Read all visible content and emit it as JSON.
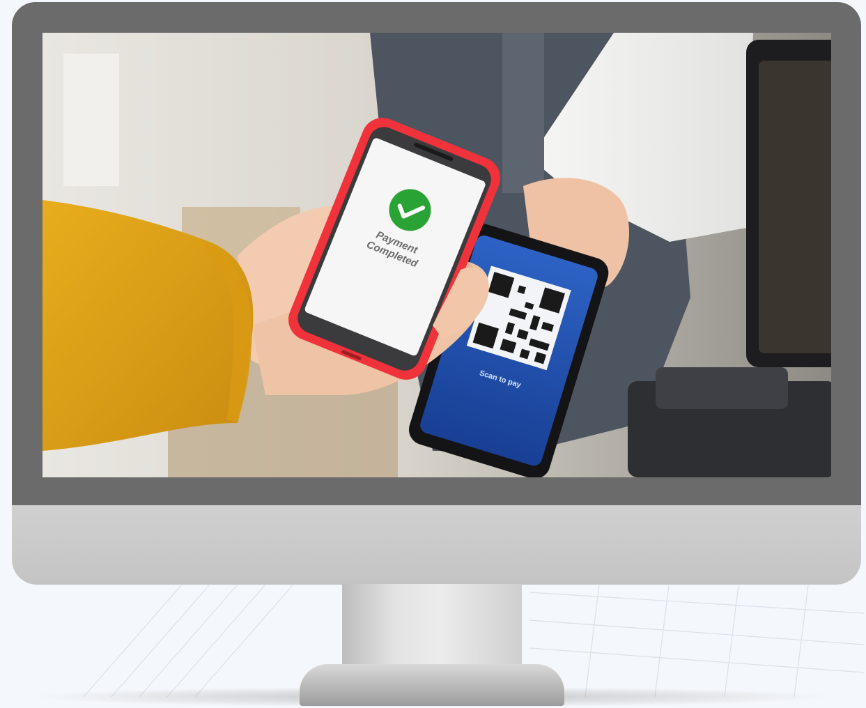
{
  "photo": {
    "front_phone": {
      "status_line_1": "Payment",
      "status_line_2": "Completed",
      "status_icon": "check-circle-icon",
      "case_color": "#f0333b"
    },
    "back_phone": {
      "caption": "Scan to pay",
      "code_icon": "qr-code-icon",
      "screen_color": "#1f4fa8"
    }
  },
  "monitor": {
    "bezel_color": "#6b6b6b",
    "chin_color": "#cbcbcb"
  }
}
